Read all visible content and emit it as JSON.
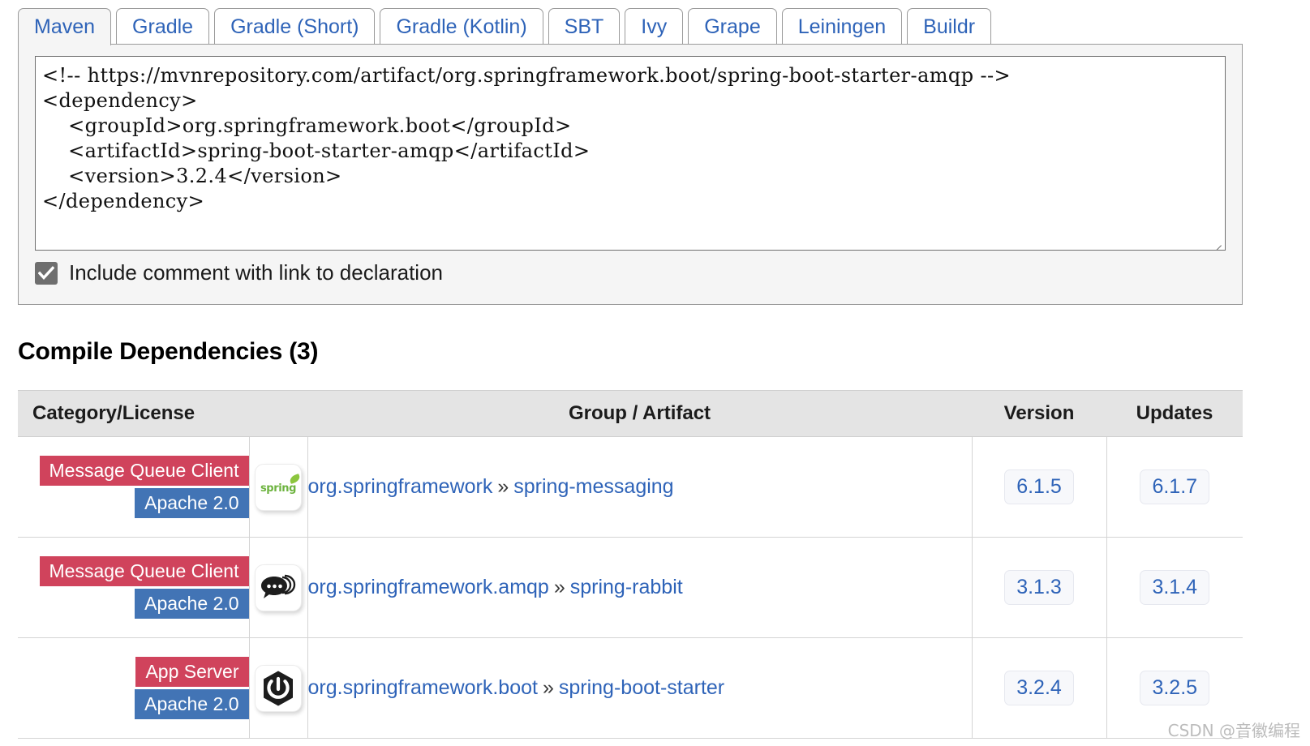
{
  "tabs": [
    {
      "label": "Maven",
      "active": true
    },
    {
      "label": "Gradle",
      "active": false
    },
    {
      "label": "Gradle (Short)",
      "active": false
    },
    {
      "label": "Gradle (Kotlin)",
      "active": false
    },
    {
      "label": "SBT",
      "active": false
    },
    {
      "label": "Ivy",
      "active": false
    },
    {
      "label": "Grape",
      "active": false
    },
    {
      "label": "Leiningen",
      "active": false
    },
    {
      "label": "Buildr",
      "active": false
    }
  ],
  "snippet": {
    "code": "<!-- https://mvnrepository.com/artifact/org.springframework.boot/spring-boot-starter-amqp -->\n<dependency>\n    <groupId>org.springframework.boot</groupId>\n    <artifactId>spring-boot-starter-amqp</artifactId>\n    <version>3.2.4</version>\n</dependency>"
  },
  "include_comment": {
    "label": "Include comment with link to declaration",
    "checked": true
  },
  "section": {
    "title": "Compile Dependencies (3)"
  },
  "table": {
    "headers": {
      "category": "Category/License",
      "icon": "",
      "group_artifact": "Group / Artifact",
      "version": "Version",
      "updates": "Updates"
    },
    "rows": [
      {
        "category": "Message Queue Client",
        "license": "Apache 2.0",
        "icon": "spring-logo-icon",
        "group": "org.springframework",
        "separator": "»",
        "artifact": "spring-messaging",
        "version": "6.1.5",
        "updates": "6.1.7"
      },
      {
        "category": "Message Queue Client",
        "license": "Apache 2.0",
        "icon": "speech-bubble-icon",
        "group": "org.springframework.amqp",
        "separator": "»",
        "artifact": "spring-rabbit",
        "version": "3.1.3",
        "updates": "3.1.4"
      },
      {
        "category": "App Server",
        "license": "Apache 2.0",
        "icon": "spring-boot-power-icon",
        "group": "org.springframework.boot",
        "separator": "»",
        "artifact": "spring-boot-starter",
        "version": "3.2.4",
        "updates": "3.2.5"
      }
    ]
  },
  "colors": {
    "category_badge": "#d0435c",
    "license_badge": "#4274b5",
    "link": "#2e63b8",
    "header_bg": "#e4e4e4",
    "panel_bg": "#f5f5f5"
  },
  "watermark": "CSDN @音徽编程"
}
